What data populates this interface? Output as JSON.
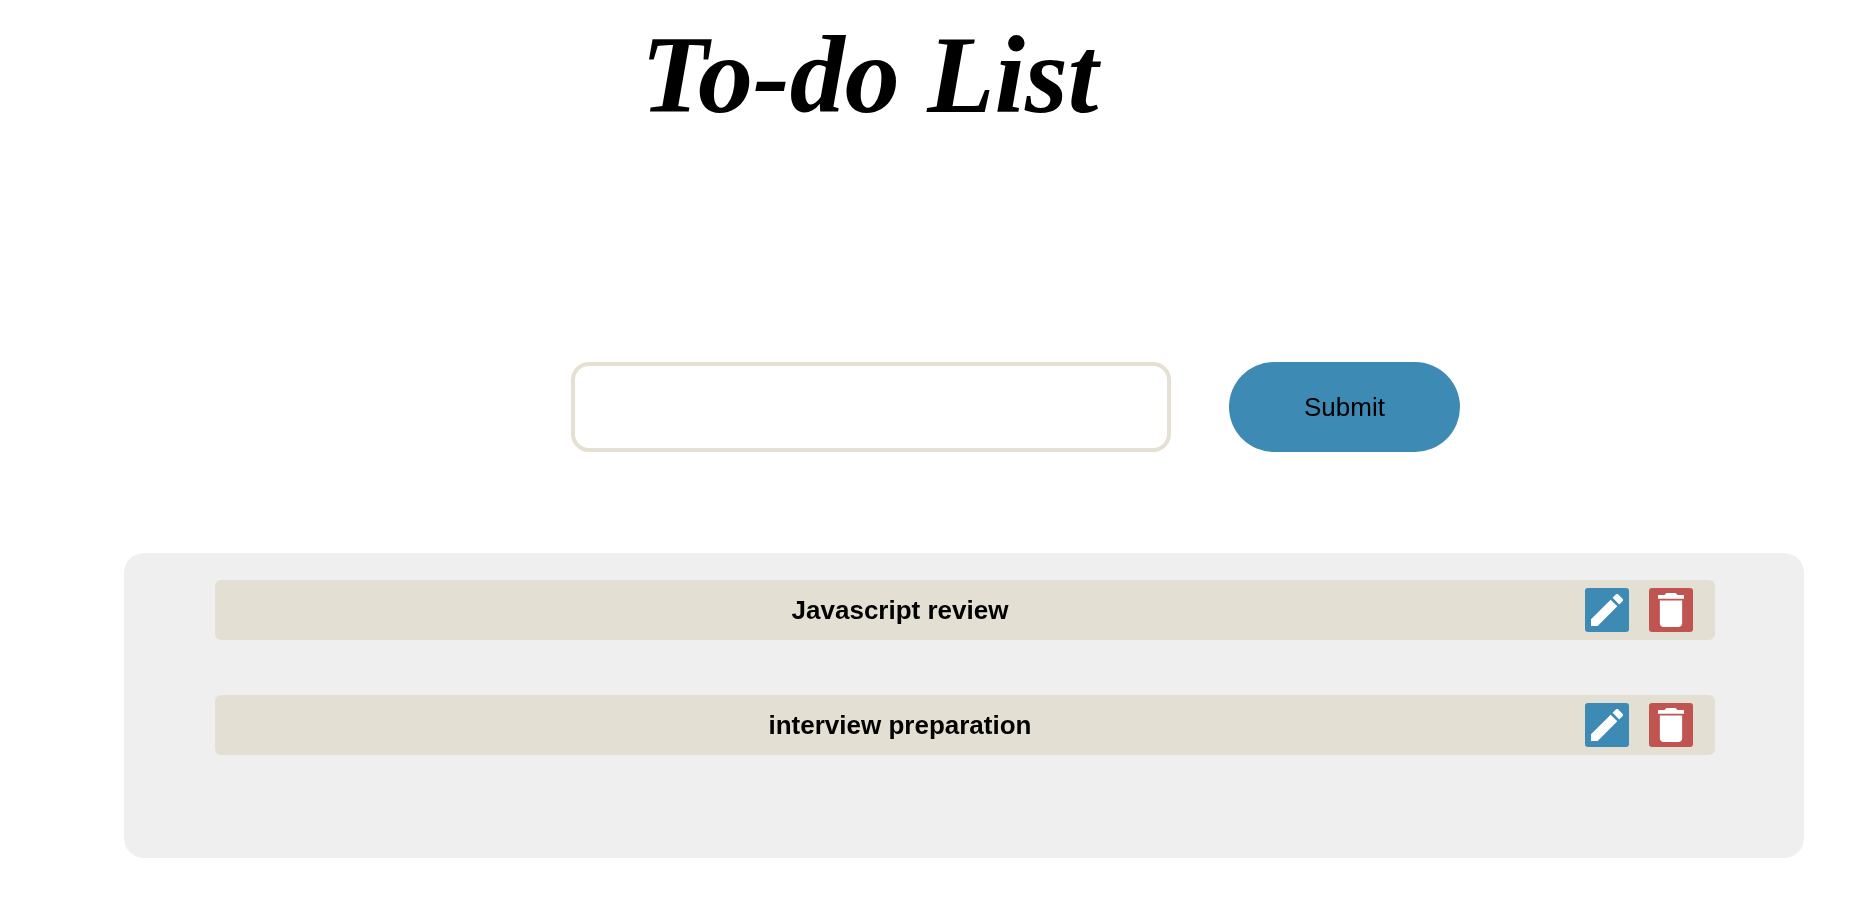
{
  "title": "To-do List",
  "new_task": {
    "button": "Submit"
  },
  "tasks": [
    {
      "text": "Javascript review"
    },
    {
      "text": "interview preparation"
    }
  ]
}
